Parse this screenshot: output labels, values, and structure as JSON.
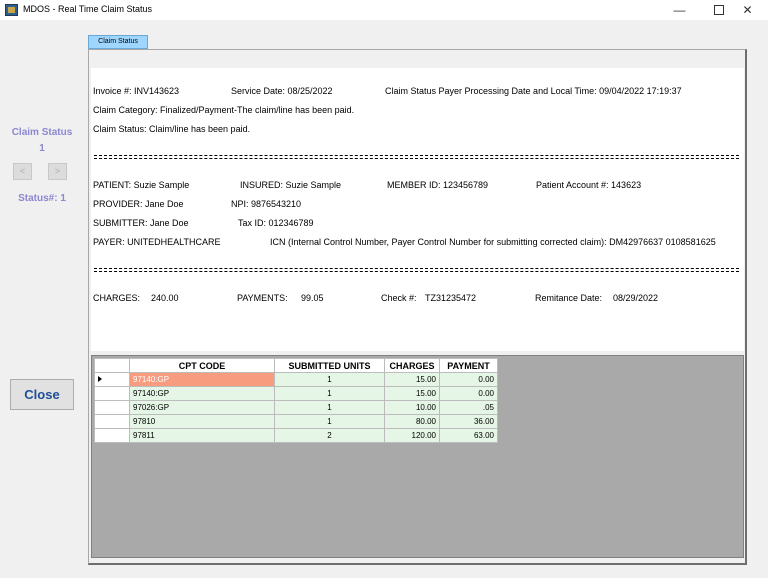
{
  "window": {
    "title": "MDOS - Real Time Claim Status"
  },
  "left": {
    "claim_status_label": "Claim Status",
    "claim_status_number": "1",
    "prev_label": "<",
    "next_label": ">",
    "status_number": "Status#: 1",
    "close_label": "Close"
  },
  "tab": {
    "label": "Claim Status"
  },
  "info": {
    "invoice": "Invoice #: INV143623",
    "service_date": "Service Date: 08/25/2022",
    "payer_processing": "Claim Status Payer Processing Date and Local Time: 09/04/2022 17:19:37",
    "claim_category": "Claim Category: Finalized/Payment-The claim/line has been paid.",
    "claim_status": "Claim Status:   Claim/line has been paid.",
    "patient": "PATIENT: Suzie Sample",
    "insured": "INSURED: Suzie Sample",
    "member_id": "MEMBER ID: 123456789",
    "patient_account": "Patient Account #: 143623",
    "provider": "PROVIDER: Jane Doe",
    "npi": "NPI: 9876543210",
    "submitter": "SUBMITTER: Jane Doe",
    "tax_id": "Tax ID: 012346789",
    "payer": "PAYER: UNITEDHEALTHCARE",
    "icn": "ICN (Internal Control Number, Payer Control Number for submitting corrected claim): DM42976637 0108581625",
    "charges_label": "CHARGES:",
    "charges_value": "240.00",
    "payments_label": "PAYMENTS:",
    "payments_value": "99.05",
    "check_label": "Check #:",
    "check_value": "TZ31235472",
    "remit_label": "Remitance Date:",
    "remit_value": "08/29/2022"
  },
  "grid": {
    "headers": {
      "code": "CPT CODE",
      "units": "SUBMITTED UNITS",
      "charges": "CHARGES",
      "payment": "PAYMENT"
    },
    "rows": [
      {
        "code": "97140:GP",
        "units": "1",
        "charges": "15.00",
        "payment": "0.00"
      },
      {
        "code": "97140:GP",
        "units": "1",
        "charges": "15.00",
        "payment": "0.00"
      },
      {
        "code": "97026:GP",
        "units": "1",
        "charges": "10.00",
        "payment": ".05"
      },
      {
        "code": "97810",
        "units": "1",
        "charges": "80.00",
        "payment": "36.00"
      },
      {
        "code": "97811",
        "units": "2",
        "charges": "120.00",
        "payment": "63.00"
      }
    ]
  }
}
